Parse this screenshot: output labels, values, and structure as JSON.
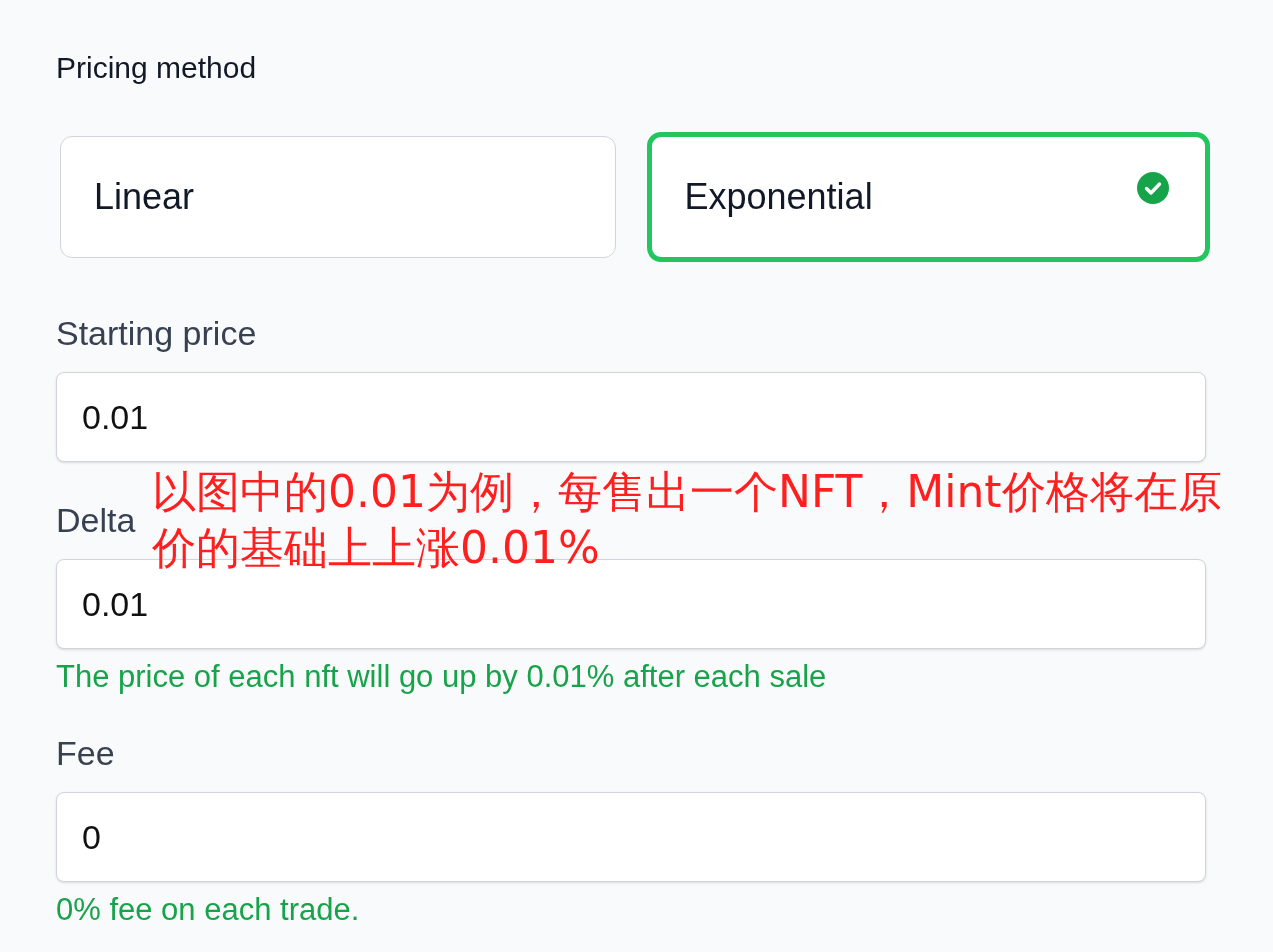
{
  "pricing_method": {
    "label": "Pricing method",
    "options": [
      {
        "label": "Linear",
        "selected": false
      },
      {
        "label": "Exponential",
        "selected": true
      }
    ]
  },
  "fields": [
    {
      "label": "Starting price",
      "value": "0.01"
    },
    {
      "label": "Delta",
      "value": "0.01",
      "hint": "The price of each nft will go up by 0.01% after each sale"
    },
    {
      "label": "Fee",
      "value": "0",
      "hint": "0% fee on each trade."
    }
  ],
  "annotation": {
    "text": "以图中的0.01为例，每售出一个NFT，Mint价格将在原价的基础上上涨0.01%"
  }
}
